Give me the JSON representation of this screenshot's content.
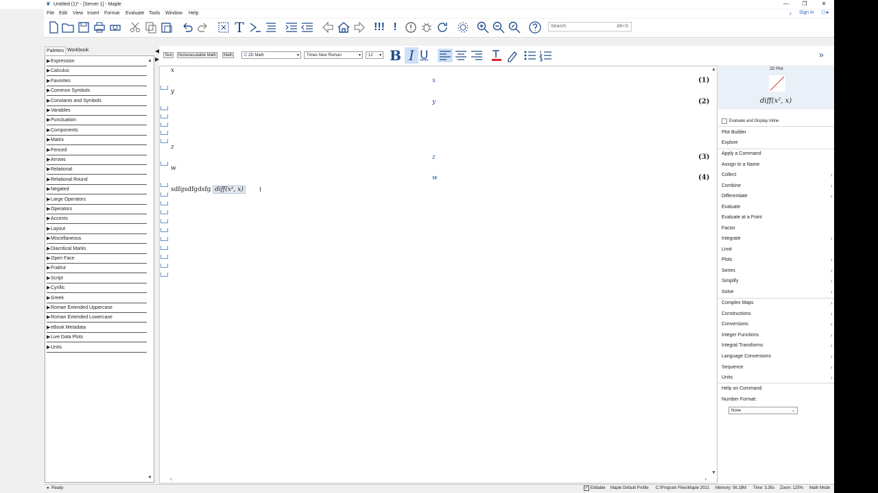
{
  "window": {
    "title": "Untitled (1)* - [Server 1] - Maple",
    "controls": [
      "—",
      "❐",
      "✕"
    ]
  },
  "menu": {
    "items": [
      "File",
      "Edit",
      "View",
      "Insert",
      "Format",
      "Evaluate",
      "Tools",
      "Window",
      "Help"
    ],
    "sign_in": "Sign in"
  },
  "toolbar": {
    "icons": [
      "new-document-icon",
      "open-folder-icon",
      "save-icon",
      "print-icon",
      "print-preview-icon",
      "cut-icon",
      "copy-icon",
      "paste-icon",
      "undo-icon",
      "redo-icon",
      "insert-code-edit-region-icon",
      "insert-text-icon",
      "insert-math-icon",
      "insert-execution-group-icon",
      "indent-icon",
      "outdent-icon",
      "back-icon",
      "home-icon",
      "forward-icon",
      "execute-all-icon",
      "execute-icon",
      "interrupt-icon",
      "debug-icon",
      "restart-icon",
      "remote-settings-icon",
      "zoom-in-icon",
      "zoom-out-icon",
      "zoom-magnify-icon",
      "help-icon"
    ],
    "search_placeholder": "Search",
    "search_shortcut": "Alt+S"
  },
  "palettes": {
    "tabs": [
      "Palettes",
      "Workbook"
    ],
    "items": [
      "Expression",
      "Calculus",
      "Favorites",
      "Common Symbols",
      "Constants and Symbols",
      "Variables",
      "Punctuation",
      "Components",
      "Matrix",
      "Fenced",
      "Arrows",
      "Relational",
      "Relational Round",
      "Negated",
      "Large Operators",
      "Operators",
      "Accents",
      "Layout",
      "Miscellaneous",
      "Diacritical Marks",
      "Open Face",
      "Fraktur",
      "Script",
      "Cyrillic",
      "Greek",
      "Roman Extended Uppercase",
      "Roman Extended Lowercase",
      "eBook Metadata",
      "Live Data Plots",
      "Units"
    ]
  },
  "formatbar": {
    "text_btn": "Text",
    "nonexec_btn": "Nonexecutable Math",
    "math_btn": "Math",
    "style": "2D Math",
    "font": "Times New Roman",
    "size": "12",
    "bold": "B",
    "italic": "I",
    "underline": "U"
  },
  "document": {
    "inputs": [
      "x",
      "y",
      "z",
      "w"
    ],
    "outputs": [
      "x",
      "y",
      "z",
      "w"
    ],
    "labels": [
      "(1)",
      "(2)",
      "(3)",
      "(4)"
    ],
    "text_line_prefix": "sdfgsdfgdsfg",
    "text_line_math": "diff(x², x)"
  },
  "context_panel": {
    "preview_title": "2D Plot",
    "preview_expr": "diff(x², x)",
    "evaluate_inline": "Evaluate and Display Inline",
    "group1": [
      "Plot Builder",
      "Explore"
    ],
    "group2": [
      "Apply a Command",
      "Assign to a Name",
      "Collect",
      "Combine",
      "Differentiate",
      "Evaluate",
      "Evaluate at a Point",
      "Factor",
      "Integrate",
      "Limit",
      "Plots",
      "Series",
      "Simplify",
      "Solve"
    ],
    "group2_submenu": [
      false,
      false,
      true,
      true,
      true,
      false,
      false,
      false,
      true,
      false,
      true,
      true,
      true,
      true
    ],
    "group3": [
      "Complex Maps",
      "Constructions",
      "Conversions",
      "Integer Functions",
      "Integral Transforms",
      "Language Conversions",
      "Sequence",
      "Units"
    ],
    "help_on_command": "Help on Command",
    "number_format_label": "Number Format:",
    "number_format_value": "None"
  },
  "status": {
    "ready": "Ready",
    "editable": "Editable",
    "profile": "Maple Default Profile",
    "path": "C:\\Program Files\\Maple 2021",
    "memory": "Memory: 56.18M",
    "time": "Time: 3.35s",
    "zoom": "Zoom: 125%",
    "mode": "Math Mode"
  },
  "colors": {
    "accent": "#1f4a8a",
    "math_output": "#1d4aa8",
    "selection": "#cfe0f5",
    "link": "#2a63c6"
  }
}
